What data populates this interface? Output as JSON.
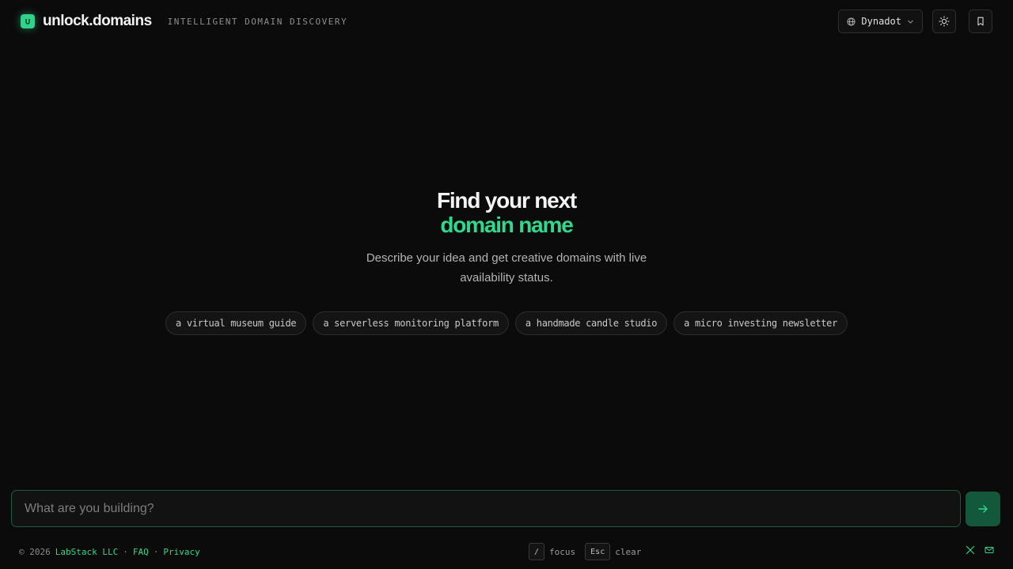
{
  "header": {
    "brand": "unlock.domains",
    "tagline": "INTELLIGENT DOMAIN DISCOVERY",
    "registrar_label": "Dynadot"
  },
  "hero": {
    "title_line1": "Find your next",
    "title_line2": "domain name",
    "subtitle": "Describe your idea and get creative domains with live availability status."
  },
  "suggestions": [
    "a virtual museum guide",
    "a serverless monitoring platform",
    "a handmade candle studio",
    "a micro investing newsletter"
  ],
  "search": {
    "placeholder": "What are you building?",
    "value": ""
  },
  "footer": {
    "copyright": "© 2026",
    "company": "LabStack LLC",
    "sep1": "·",
    "faq": "FAQ",
    "sep2": "·",
    "privacy": "Privacy",
    "shortcuts": [
      {
        "key": "/",
        "label": "focus"
      },
      {
        "key": "Esc",
        "label": "clear"
      }
    ]
  },
  "colors": {
    "accent": "#2fd88f",
    "background": "#0b0b0b",
    "input_border": "#1e5a3f",
    "submit_bg": "#14583c"
  },
  "icons": {
    "logo": "unlock-icon",
    "registrar": "globe-icon",
    "dropdown": "chevron-down-icon",
    "theme": "sun-icon",
    "saved": "bookmark-icon",
    "submit": "arrow-right-icon",
    "social_x": "x-icon",
    "contact": "mail-icon"
  }
}
